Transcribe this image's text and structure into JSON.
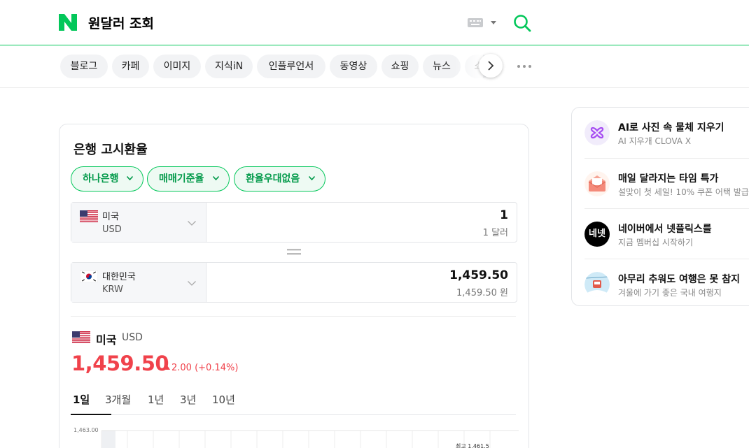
{
  "header": {
    "query": "원달러 조회"
  },
  "tabs": [
    "블로그",
    "카페",
    "이미지",
    "지식iN",
    "인플루언서",
    "동영상",
    "쇼핑",
    "뉴스",
    "쇼"
  ],
  "card": {
    "title": "은행 고시환율",
    "filters": [
      "하나은행",
      "매매기준율",
      "환율우대없음"
    ],
    "converter": {
      "from": {
        "country": "미국",
        "code": "USD",
        "value": "1",
        "sub": "1 달러"
      },
      "to": {
        "country": "대한민국",
        "code": "KRW",
        "value": "1,459.50",
        "sub": "1,459.50 원"
      }
    },
    "rate": {
      "country": "미국",
      "code": "USD",
      "value": "1,459.50",
      "change": "2.00 (+0.14%)"
    },
    "periods": [
      "1일",
      "3개월",
      "1년",
      "3년",
      "10년"
    ],
    "chart": {
      "y_tick": "1,463.00",
      "high_label": "최고 1,461.5"
    }
  },
  "panel": {
    "ads": [
      {
        "title": "AI로 사진 속 물체 지우기",
        "sub": "AI 지우개 CLOVA X",
        "icon": "clova-x-icon"
      },
      {
        "title": "매일 달라지는 타임 특가",
        "sub": "설맞이 첫 세일! 10% 쿠폰 어택 발급",
        "icon": "coupon-envelope-icon"
      },
      {
        "title": "네이버에서 넷플릭스를",
        "sub": "지금 멤버십 시작하기",
        "icon": "netflix-badge-icon",
        "badge": "네넷"
      },
      {
        "title": "아무리 추워도 여행은 못 참지",
        "sub": "겨울에 가기 좋은 국내 여행지",
        "icon": "ski-lift-icon"
      }
    ]
  },
  "colors": {
    "brand": "#03c75a",
    "up": "#f0424b"
  }
}
